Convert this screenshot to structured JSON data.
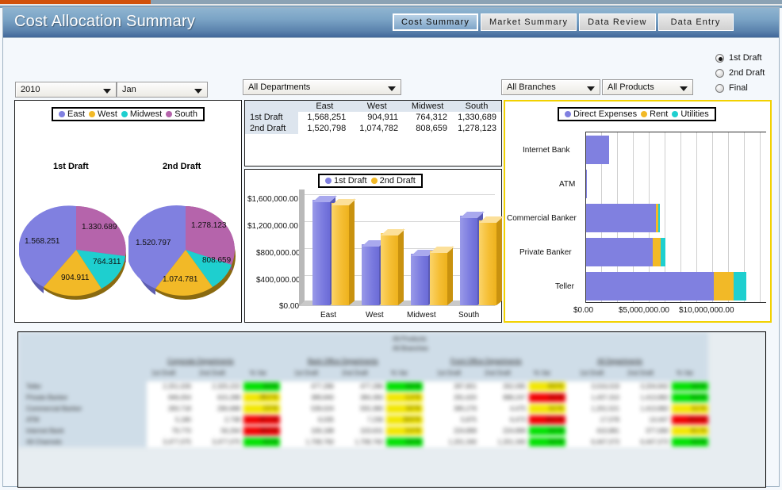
{
  "window": {
    "title": "Cost Allocation Summary"
  },
  "tabs": [
    {
      "label": "Cost Summary",
      "active": true
    },
    {
      "label": "Market Summary",
      "active": false
    },
    {
      "label": "Data Review",
      "active": false
    },
    {
      "label": "Data Entry",
      "active": false
    }
  ],
  "filters": {
    "year": "2010",
    "month": "Jan",
    "department": "All Departments",
    "branch": "All Branches",
    "product": "All Products"
  },
  "draft_options": [
    {
      "label": "1st Draft",
      "selected": true
    },
    {
      "label": "2nd Draft",
      "selected": false
    },
    {
      "label": "Final",
      "selected": false
    }
  ],
  "colors": {
    "east": "#8080e0",
    "west": "#f2b927",
    "midwest": "#1ecfcf",
    "south": "#b564ab",
    "draft1": "#8080e0",
    "draft2": "#f2b927",
    "direct_expenses": "#8080e0",
    "rent": "#f2b927",
    "utilities": "#1ecfcf",
    "header_accent": "#5b83ad",
    "highlight_border": "#f2d100",
    "pct_good": "#00e000",
    "pct_warn": "#f2e600",
    "pct_bad": "#f20000"
  },
  "pie_panel": {
    "legend": [
      {
        "label": "East",
        "color": "#8080e0"
      },
      {
        "label": "West",
        "color": "#f2b927"
      },
      {
        "label": "Midwest",
        "color": "#1ecfcf"
      },
      {
        "label": "South",
        "color": "#b564ab"
      }
    ],
    "charts": [
      {
        "title": "1st Draft",
        "values": [
          "1.568.251",
          "904.911",
          "764.311",
          "1.330.689"
        ]
      },
      {
        "title": "2nd Draft",
        "values": [
          "1.520.797",
          "1.074.781",
          "808.659",
          "1.278.123"
        ]
      }
    ]
  },
  "summary_table": {
    "columns": [
      "",
      "East",
      "West",
      "Midwest",
      "South"
    ],
    "rows": [
      {
        "label": "1st Draft",
        "values": [
          "1,568,251",
          "904,911",
          "764,312",
          "1,330,689"
        ]
      },
      {
        "label": "2nd Draft",
        "values": [
          "1,520,798",
          "1,074,782",
          "808,659",
          "1,278,123"
        ]
      }
    ]
  },
  "chart_data": [
    {
      "type": "pie",
      "title": "1st Draft",
      "categories": [
        "East",
        "West",
        "Midwest",
        "South"
      ],
      "values": [
        1568251,
        904911,
        764311,
        1330689
      ],
      "labels": [
        "1.568.251",
        "904.911",
        "764.311",
        "1.330.689"
      ],
      "colors": [
        "#8080e0",
        "#f2b927",
        "#1ecfcf",
        "#b564ab"
      ],
      "legend_position": "top"
    },
    {
      "type": "pie",
      "title": "2nd Draft",
      "categories": [
        "East",
        "West",
        "Midwest",
        "South"
      ],
      "values": [
        1520797,
        1074781,
        808659,
        1278123
      ],
      "labels": [
        "1.520.797",
        "1.074.781",
        "808.659",
        "1.278.123"
      ],
      "colors": [
        "#8080e0",
        "#f2b927",
        "#1ecfcf",
        "#b564ab"
      ],
      "legend_position": "top"
    },
    {
      "type": "bar",
      "title": "",
      "categories": [
        "East",
        "West",
        "Midwest",
        "South"
      ],
      "series": [
        {
          "name": "1st Draft",
          "values": [
            1568251,
            904911,
            764312,
            1330689
          ],
          "color": "#8080e0"
        },
        {
          "name": "2nd Draft",
          "values": [
            1520798,
            1074782,
            808659,
            1278123
          ],
          "color": "#f2b927"
        }
      ],
      "xlabel": "",
      "ylabel": "",
      "ylim": [
        0,
        1800000
      ],
      "yticks": [
        "$0.00",
        "$400,000.00",
        "$800,000.00",
        "$1,200,000.00",
        "$1,600,000.00"
      ],
      "grid": true,
      "legend_position": "top"
    },
    {
      "type": "bar",
      "orientation": "horizontal",
      "stacked": true,
      "title": "",
      "categories": [
        "Internet Bank",
        "ATM",
        "Commercial Banker",
        "Private Banker",
        "Teller"
      ],
      "series": [
        {
          "name": "Direct Expenses",
          "values": [
            1250000,
            0,
            4350000,
            4150000,
            9500000
          ],
          "color": "#8080e0"
        },
        {
          "name": "Rent",
          "values": [
            0,
            0,
            130000,
            700000,
            1500000
          ],
          "color": "#f2b927"
        },
        {
          "name": "Utilities",
          "values": [
            0,
            0,
            70000,
            300000,
            900000
          ],
          "color": "#1ecfcf"
        }
      ],
      "xlabel": "",
      "ylabel": "",
      "xlim": [
        0,
        13500000
      ],
      "xticks": [
        "$0.00",
        "$5,000,000.00",
        "$10,000,000.00"
      ],
      "grid": true,
      "legend_position": "top"
    }
  ],
  "bar_chart": {
    "legend": [
      {
        "label": "1st Draft",
        "color": "#8080e0"
      },
      {
        "label": "2nd Draft",
        "color": "#f2b927"
      }
    ],
    "yticks": [
      "$1,600,000.00",
      "$1,200,000.00",
      "$800,000.00",
      "$400,000.00",
      "$0.00"
    ],
    "xticks": [
      "East",
      "West",
      "Midwest",
      "South"
    ]
  },
  "stacked_chart": {
    "legend": [
      {
        "label": "Direct Expenses",
        "color": "#8080e0"
      },
      {
        "label": "Rent",
        "color": "#f2b927"
      },
      {
        "label": "Utilities",
        "color": "#1ecfcf"
      }
    ],
    "yticks": [
      "Internet Bank",
      "ATM",
      "Commercial Banker",
      "Private Banker",
      "Teller"
    ],
    "xticks": [
      "$0.00",
      "$5,000,000.00",
      "$10,000,000.00"
    ]
  },
  "detail_table": {
    "scope_lines": [
      "All Products",
      "All Branches"
    ],
    "group_headers": [
      "Corporate Departments",
      "Back Office Departments",
      "Front Office Departments",
      "All Departments"
    ],
    "sub_headers": [
      "1st Draft",
      "2nd Draft",
      "% Var"
    ],
    "row_labels": [
      "Teller",
      "Private Banker",
      "Commercial Banker",
      "ATM",
      "Internet Bank",
      "All Channels"
    ],
    "groups": [
      {
        "name": "Corporate Departments",
        "rows": [
          {
            "d1": "2,251,026",
            "d2": "2,325,222",
            "var": "3.3 %",
            "flag": "good"
          },
          {
            "d1": "946,054",
            "d2": "615,288",
            "var": "-35.0 %",
            "flag": "warn"
          },
          {
            "d1": "283,718",
            "d2": "290,688",
            "var": "2.5 %",
            "flag": "warn"
          },
          {
            "d1": "5,180",
            "d2": "2,738",
            "var": "-47.1 %",
            "flag": "bad"
          },
          {
            "d1": "79,770",
            "d2": "56,264",
            "var": "-29.5 %",
            "flag": "bad"
          },
          {
            "d1": "3,477,075",
            "d2": "3,477,075",
            "var": "0.0 %",
            "flag": "good"
          }
        ]
      },
      {
        "name": "Back Office Departments",
        "rows": [
          {
            "d1": "477,286",
            "d2": "477,286",
            "var": "0.0 %",
            "flag": "good"
          },
          {
            "d1": "389,840",
            "d2": "384,360",
            "var": "-1.4 %",
            "flag": "warn"
          },
          {
            "d1": "539,024",
            "d2": "555,380",
            "var": "3.0 %",
            "flag": "warn"
          },
          {
            "d1": "6,035",
            "d2": "7,236",
            "var": "19.9 %",
            "flag": "good"
          },
          {
            "d1": "106,188",
            "d2": "103,631",
            "var": "-2.4 %",
            "flag": "warn"
          },
          {
            "d1": "1,708,760",
            "d2": "1,708,760",
            "var": "0.0 %",
            "flag": "good"
          }
        ]
      },
      {
        "name": "Front Office Departments",
        "rows": [
          {
            "d1": "287,801",
            "d2": "262,095",
            "var": "-8.9 %",
            "flag": "warn"
          },
          {
            "d1": "291,620",
            "d2": "988,247",
            "var": "3.2 %",
            "flag": "bad"
          },
          {
            "d1": "395,279",
            "d2": "4,475",
            "var": "3.2 %",
            "flag": "warn"
          },
          {
            "d1": "5,875",
            "d2": "6,473",
            "var": "10.2 %",
            "flag": "good"
          },
          {
            "d1": "224,899",
            "d2": "224,899",
            "var": "0.0 %",
            "flag": "warn"
          },
          {
            "d1": "1,201,340",
            "d2": "1,201,340",
            "var": "0.0 %",
            "flag": "good"
          }
        ]
      },
      {
        "name": "All Departments",
        "rows": [
          {
            "d1": "3,016,019",
            "d2": "3,204,842",
            "var": "3.0 %",
            "flag": "good"
          },
          {
            "d1": "1,437,310",
            "d2": "1,413,882",
            "var": "-5.0 %",
            "flag": "good"
          },
          {
            "d1": "1,201,521",
            "d2": "1,413,882",
            "var": "3.2 %",
            "flag": "warn"
          },
          {
            "d1": "17,078",
            "d2": "14,447",
            "var": "-15.4 %",
            "flag": "bad"
          },
          {
            "d1": "410,881",
            "d2": "377,690",
            "var": "-8.1 %",
            "flag": "warn"
          },
          {
            "d1": "6,447,073",
            "d2": "6,447,073",
            "var": "0.0 %",
            "flag": "good"
          }
        ]
      }
    ]
  }
}
